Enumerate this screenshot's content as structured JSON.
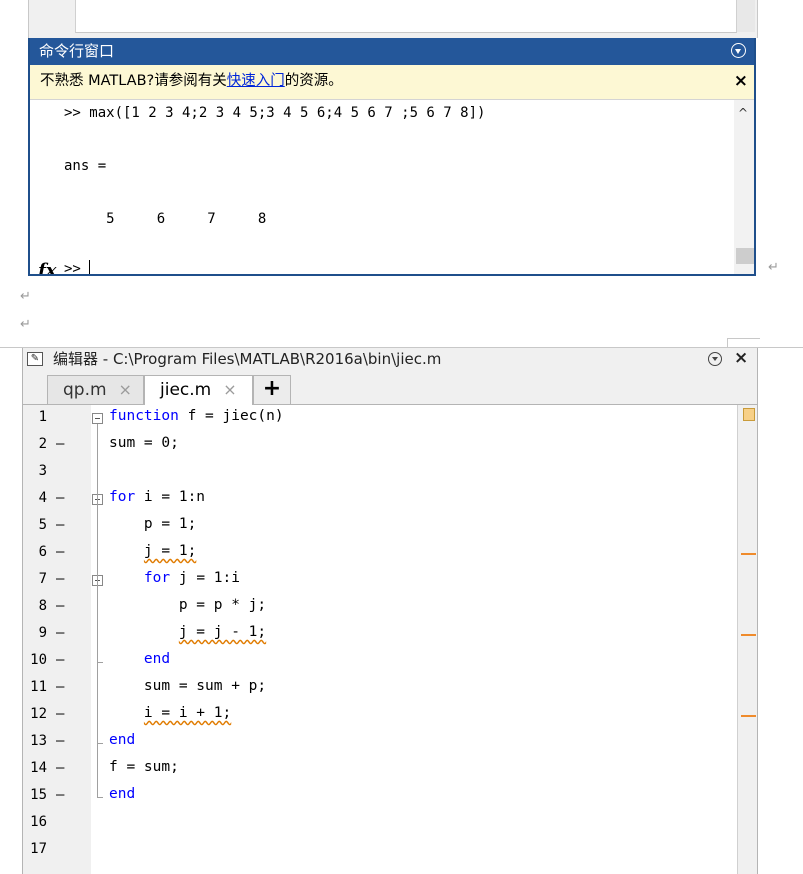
{
  "command_window": {
    "title": "命令行窗口",
    "notice": {
      "prefix": "不熟悉 MATLAB?请参阅有关",
      "link": "快速入门",
      "suffix": "的资源。",
      "close": "×"
    },
    "lines": [
      ">> max([1 2 3 4;2 3 4 5;3 4 5 6;4 5 6 7 ;5 6 7 8])",
      "ans =",
      "     5     6     7     8"
    ],
    "prompt": ">> ",
    "fx_label": "fx"
  },
  "paragraph_marks": [
    "↵",
    "↵",
    "↵"
  ],
  "editor": {
    "title": "编辑器 - C:\\Program Files\\MATLAB\\R2016a\\bin\\jiec.m",
    "close": "×",
    "tabs": [
      {
        "label": "qp.m",
        "active": false,
        "close": "×"
      },
      {
        "label": "jiec.m",
        "active": true,
        "close": "×"
      }
    ],
    "add_tab": "+",
    "lines": [
      {
        "num": "1",
        "dash": "",
        "pre": "",
        "kw": "function",
        "post": " f = jiec(n)"
      },
      {
        "num": "2",
        "dash": "—",
        "pre": "",
        "kw": "",
        "post": "sum = 0;"
      },
      {
        "num": "3",
        "dash": "",
        "pre": "",
        "kw": "",
        "post": ""
      },
      {
        "num": "4",
        "dash": "—",
        "pre": "",
        "kw": "for",
        "post": " i = 1:n"
      },
      {
        "num": "5",
        "dash": "—",
        "pre": "    ",
        "kw": "",
        "post": "p = 1;"
      },
      {
        "num": "6",
        "dash": "—",
        "pre": "    ",
        "kw": "",
        "post": "j = 1;"
      },
      {
        "num": "7",
        "dash": "—",
        "pre": "    ",
        "kw": "for",
        "post": " j = 1:i"
      },
      {
        "num": "8",
        "dash": "—",
        "pre": "        ",
        "kw": "",
        "post": "p = p * j;"
      },
      {
        "num": "9",
        "dash": "—",
        "pre": "        ",
        "kw": "",
        "post": "j = j - 1;"
      },
      {
        "num": "10",
        "dash": "—",
        "pre": "    ",
        "kw": "end",
        "post": ""
      },
      {
        "num": "11",
        "dash": "—",
        "pre": "    ",
        "kw": "",
        "post": "sum = sum + p;"
      },
      {
        "num": "12",
        "dash": "—",
        "pre": "    ",
        "kw": "",
        "post": "i = i + 1;"
      },
      {
        "num": "13",
        "dash": "—",
        "pre": "",
        "kw": "end",
        "post": ""
      },
      {
        "num": "14",
        "dash": "—",
        "pre": "",
        "kw": "",
        "post": "f = sum;"
      },
      {
        "num": "15",
        "dash": "—",
        "pre": "",
        "kw": "end",
        "post": ""
      },
      {
        "num": "16",
        "dash": "",
        "pre": "",
        "kw": "",
        "post": ""
      },
      {
        "num": "17",
        "dash": "",
        "pre": "",
        "kw": "",
        "post": ""
      }
    ],
    "colors": {
      "keyword": "#0000ff",
      "warning": "#ef8b2c",
      "title_bar": "#24579a"
    }
  }
}
